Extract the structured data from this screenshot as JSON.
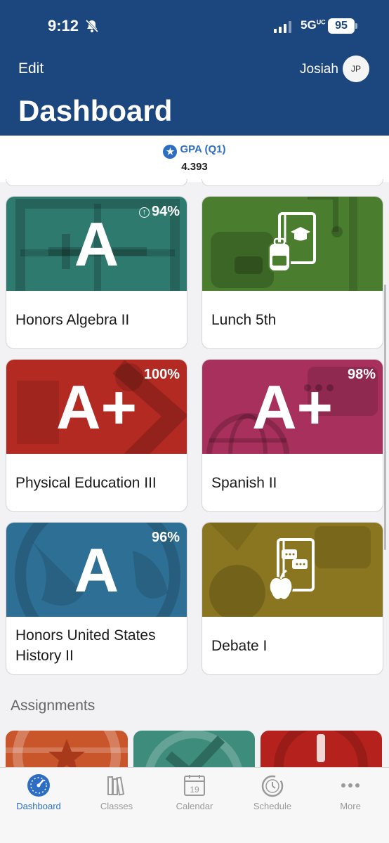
{
  "status_bar": {
    "time": "9:12",
    "network": "5G",
    "network_sup": "UC",
    "battery": "95"
  },
  "header": {
    "edit_label": "Edit",
    "user_name": "Josiah",
    "avatar_initials": "JP",
    "title": "Dashboard"
  },
  "gpa": {
    "label": "GPA (Q1)",
    "value": "4.393"
  },
  "classes": [
    {
      "name": "Honors Algebra II",
      "grade": "A",
      "percent": "94%",
      "trend": "up",
      "color": "#2f7a6f"
    },
    {
      "name": "Lunch 5th",
      "grade": "",
      "percent": "",
      "color": "#4a7d2e"
    },
    {
      "name": "Physical Education III",
      "grade": "A+",
      "percent": "100%",
      "color": "#b22a22"
    },
    {
      "name": "Spanish II",
      "grade": "A+",
      "percent": "98%",
      "color": "#a8305c"
    },
    {
      "name": "Honors United States History II",
      "grade": "A",
      "percent": "96%",
      "color": "#2e6f95"
    },
    {
      "name": "Debate I",
      "grade": "",
      "percent": "",
      "color": "#8a7620"
    }
  ],
  "assignments": {
    "title": "Assignments"
  },
  "tabs": [
    {
      "label": "Dashboard",
      "icon": "gauge-icon",
      "active": true
    },
    {
      "label": "Classes",
      "icon": "books-icon"
    },
    {
      "label": "Calendar",
      "icon": "calendar-icon",
      "day": "19"
    },
    {
      "label": "Schedule",
      "icon": "clock-icon"
    },
    {
      "label": "More",
      "icon": "more-dots-icon"
    }
  ]
}
